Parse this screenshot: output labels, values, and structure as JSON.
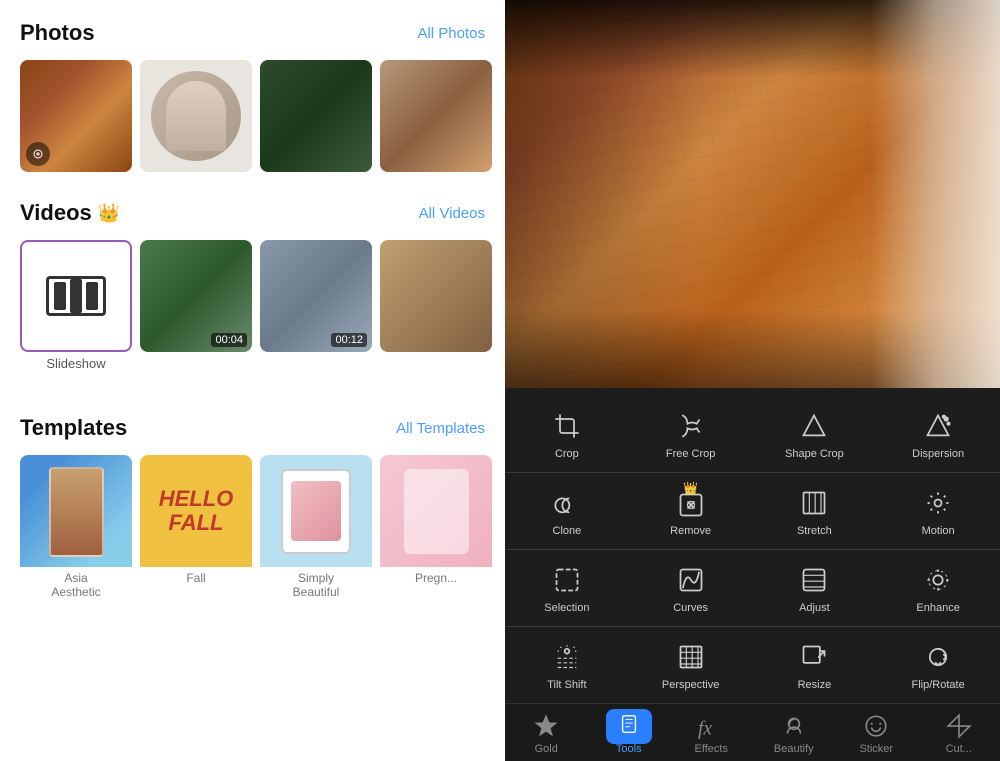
{
  "left": {
    "photos_title": "Photos",
    "photos_all": "All Photos",
    "videos_title": "Videos",
    "videos_all": "All Videos",
    "templates_title": "Templates",
    "templates_all": "All Templates",
    "slideshow_label": "Slideshow",
    "video_durations": [
      "00:04",
      "00:12"
    ],
    "templates": [
      {
        "label": "Asia Aesthetic"
      },
      {
        "label": "Fall"
      },
      {
        "label": "Simply Beautiful"
      },
      {
        "label": "Pregn..."
      }
    ]
  },
  "tools": {
    "rows": [
      [
        {
          "id": "crop",
          "label": "Crop"
        },
        {
          "id": "free-crop",
          "label": "Free Crop"
        },
        {
          "id": "shape-crop",
          "label": "Shape Crop"
        },
        {
          "id": "dispersion",
          "label": "Dispersion"
        }
      ],
      [
        {
          "id": "clone",
          "label": "Clone"
        },
        {
          "id": "remove",
          "label": "Remove",
          "premium": true
        },
        {
          "id": "stretch",
          "label": "Stretch"
        },
        {
          "id": "motion",
          "label": "Motion"
        }
      ],
      [
        {
          "id": "selection",
          "label": "Selection"
        },
        {
          "id": "curves",
          "label": "Curves"
        },
        {
          "id": "adjust",
          "label": "Adjust"
        },
        {
          "id": "enhance",
          "label": "Enhance"
        }
      ],
      [
        {
          "id": "tilt-shift",
          "label": "Tilt Shift"
        },
        {
          "id": "perspective",
          "label": "Perspective"
        },
        {
          "id": "resize",
          "label": "Resize"
        },
        {
          "id": "flip-rotate",
          "label": "Flip/Rotate"
        }
      ]
    ]
  },
  "bottom_nav": [
    {
      "id": "gold",
      "label": "Gold"
    },
    {
      "id": "tools",
      "label": "Tools",
      "active": true
    },
    {
      "id": "effects",
      "label": "Effects"
    },
    {
      "id": "beautify",
      "label": "Beautify"
    },
    {
      "id": "sticker",
      "label": "Sticker"
    },
    {
      "id": "cutout",
      "label": "Cut..."
    }
  ]
}
